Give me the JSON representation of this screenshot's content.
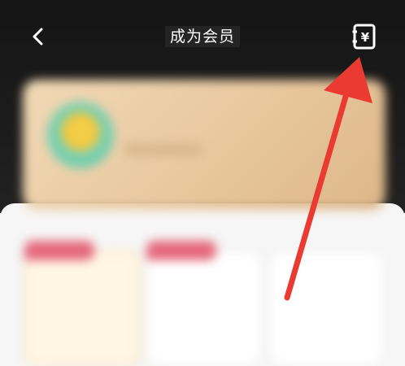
{
  "nav": {
    "back_icon": "chevron-left-icon",
    "title": "成为会员",
    "orders_icon": "yuan-receipt-icon",
    "orders_glyph": "¥"
  },
  "colors": {
    "header_bg": "#151515",
    "card_gold": "#e8c79d",
    "tag_pink": "#e4677b",
    "annotation_red": "#ea3a31"
  }
}
